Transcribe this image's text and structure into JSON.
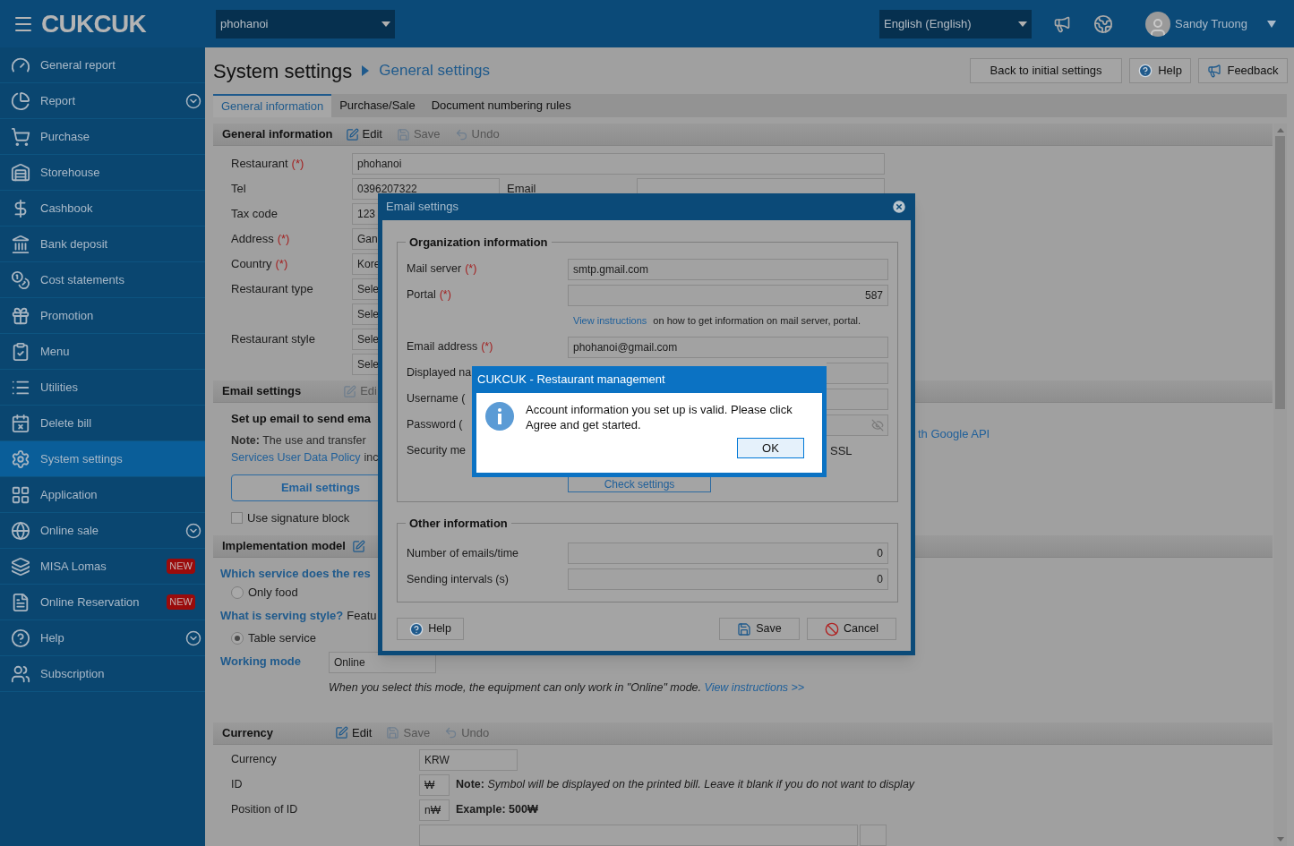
{
  "header": {
    "logo": "CUKCUK",
    "restaurant_select": "phohanoi",
    "language_select": "English (English)",
    "user": "Sandy Truong"
  },
  "sidebar": {
    "items": [
      {
        "label": "General report",
        "selected": false,
        "expandable": false
      },
      {
        "label": "Report",
        "selected": false,
        "expandable": true
      },
      {
        "label": "Purchase",
        "selected": false,
        "expandable": false
      },
      {
        "label": "Storehouse",
        "selected": false,
        "expandable": false
      },
      {
        "label": "Cashbook",
        "selected": false,
        "expandable": false
      },
      {
        "label": "Bank deposit",
        "selected": false,
        "expandable": false
      },
      {
        "label": "Cost statements",
        "selected": false,
        "expandable": false
      },
      {
        "label": "Promotion",
        "selected": false,
        "expandable": false
      },
      {
        "label": "Menu",
        "selected": false,
        "expandable": false
      },
      {
        "label": "Utilities",
        "selected": false,
        "expandable": false
      },
      {
        "label": "Delete bill",
        "selected": false,
        "expandable": false
      },
      {
        "label": "System settings",
        "selected": true,
        "expandable": false
      },
      {
        "label": "Application",
        "selected": false,
        "expandable": false
      },
      {
        "label": "Online sale",
        "selected": false,
        "expandable": true
      },
      {
        "label": "MISA Lomas",
        "selected": false,
        "expandable": false,
        "badge": "NEW"
      },
      {
        "label": "Online Reservation",
        "selected": false,
        "expandable": false,
        "badge": "NEW"
      },
      {
        "label": "Help",
        "selected": false,
        "expandable": true
      },
      {
        "label": "Subscription",
        "selected": false,
        "expandable": false
      }
    ]
  },
  "page": {
    "title": "System settings",
    "breadcrumb": "General settings",
    "buttons": [
      {
        "label": "Back to initial settings",
        "kind": "plain"
      },
      {
        "label": "Help",
        "kind": "help"
      },
      {
        "label": "Feedback",
        "kind": "feedback"
      }
    ]
  },
  "tabs": [
    {
      "label": "General information",
      "selected": true
    },
    {
      "label": "Purchase/Sale",
      "selected": false
    },
    {
      "label": "Document numbering rules",
      "selected": false
    }
  ],
  "general_information": {
    "title": "General information",
    "actions": [
      {
        "label": "Edit",
        "kind": "edit",
        "disabled": false
      },
      {
        "label": "Save",
        "kind": "save",
        "disabled": true
      },
      {
        "label": "Undo",
        "kind": "undo",
        "disabled": true
      }
    ],
    "fields": [
      {
        "label": "Restaurant",
        "marker": "(*)",
        "value": "phohanoi",
        "kind": "wide"
      },
      {
        "label": "Tel",
        "value": "0396207322",
        "kind": "with_email",
        "extra_label": "Email"
      },
      {
        "label": "Tax code",
        "value": "123",
        "kind": "short"
      },
      {
        "label": "Address",
        "marker": "(*)",
        "value": "Gan",
        "kind": "short"
      },
      {
        "label": "Country",
        "marker": "(*)",
        "value": "Kore",
        "kind": "short"
      },
      {
        "label": "Restaurant type",
        "value": "Sele",
        "kind": "short"
      },
      {
        "value": "Sele",
        "kind": "short"
      },
      {
        "label": "Restaurant style",
        "value": "Sele",
        "kind": "short"
      },
      {
        "value": "Sele",
        "kind": "short"
      }
    ]
  },
  "email_settings": {
    "title": "Email settings",
    "actions": [
      {
        "label": "Edi",
        "kind": "edit",
        "disabled": true
      }
    ],
    "heading": "Set up email to send ema",
    "note": "**Note:** The use and transfer",
    "policy_link": "Services User Data Policy",
    "policy_rest": "inc",
    "api_link": "th Google API",
    "button": "Email settings",
    "signature": {
      "label": "Use signature block",
      "checked": false
    }
  },
  "implementation_model": {
    "title": "Implementation model",
    "service_question": "Which service does the res",
    "service_options": [
      {
        "label": "Only food",
        "selected": false
      }
    ],
    "style_question": "What is serving style?",
    "style_note": "Featu",
    "style_options": [
      {
        "label": "Table service",
        "selected": true
      }
    ],
    "working_mode": {
      "label": "Working mode",
      "value": "Online",
      "description": "When you select this mode, the equipment can only work in \"Online\" mode.",
      "link": "View instructions >>"
    }
  },
  "currency": {
    "title": "Currency",
    "actions": [
      {
        "label": "Edit",
        "kind": "edit",
        "disabled": false
      },
      {
        "label": "Save",
        "kind": "save",
        "disabled": true
      },
      {
        "label": "Undo",
        "kind": "undo",
        "disabled": true
      }
    ],
    "fields": [
      {
        "label": "Currency",
        "value": "KRW",
        "kind": "wide"
      },
      {
        "label": "ID",
        "value": "₩",
        "kind": "symbol",
        "note": "**Note:** *Symbol will be displayed on the printed bill. Leave it blank if you do not want to display*"
      },
      {
        "label": "Position of ID",
        "value": "n₩",
        "kind": "symbol",
        "note": "**Example: 500₩**"
      }
    ]
  },
  "email_dialog": {
    "title": "Email settings",
    "organization": {
      "title": "Organization information",
      "rows": [
        {
          "kind": "input",
          "label": "Mail server",
          "marker": "(*)",
          "value": "smtp.gmail.com"
        },
        {
          "kind": "number",
          "label": "Portal",
          "marker": "(*)",
          "value": "587"
        },
        {
          "kind": "note",
          "link": "View instructions",
          "text": "on how to get information on mail server, portal."
        },
        {
          "kind": "input",
          "label": "Email address",
          "marker": "(*)",
          "value": "phohanoi@gmail.com"
        },
        {
          "kind": "partial_input",
          "label": "Displayed na"
        },
        {
          "kind": "partial_input",
          "label": "Username ("
        },
        {
          "kind": "password",
          "label": "Password ("
        },
        {
          "kind": "security",
          "label": "Security me",
          "option": "SSL"
        }
      ],
      "check_button": "Check settings"
    },
    "other": {
      "title": "Other information",
      "rows": [
        {
          "kind": "number",
          "label": "Number of emails/time",
          "value": "0"
        },
        {
          "kind": "number",
          "label": "Sending intervals (s)",
          "value": "0"
        }
      ]
    },
    "buttons": [
      {
        "label": "Help",
        "kind": "help"
      },
      {
        "label": "Save",
        "kind": "save"
      },
      {
        "label": "Cancel",
        "kind": "cancel"
      }
    ]
  },
  "message_box": {
    "title": "CUKCUK - Restaurant management",
    "text": "Account information you set up is valid. Please click Agree and get started.",
    "ok": "OK"
  }
}
